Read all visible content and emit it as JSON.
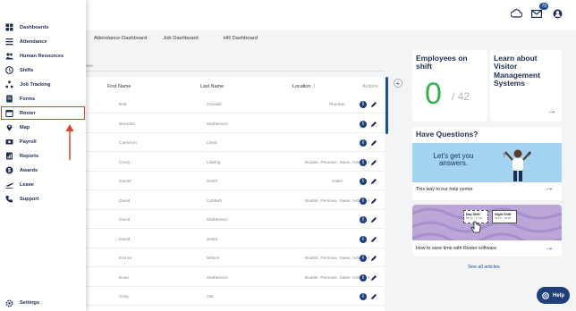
{
  "header": {
    "icons": [
      "cloud-icon",
      "mail-icon",
      "user-icon"
    ],
    "mail_badge": "79"
  },
  "tabs": [
    "Attendance Dashboard",
    "Job Dashboard",
    "HR Dashboard"
  ],
  "tab_partial": "ees",
  "table": {
    "headers": {
      "first": "First Name",
      "last": "Last Name",
      "location": "Location ⋮",
      "actions": "Actions"
    },
    "rows": [
      {
        "first": "Bob",
        "last": "Goodall",
        "location": "Plumber"
      },
      {
        "first": "Brandon",
        "last": "Matheeson",
        "location": ""
      },
      {
        "first": "Cameron",
        "last": "Lloyd",
        "location": ""
      },
      {
        "first": "Crazy",
        "last": "Littelrig",
        "location": "Builder, Pennisie, Sales, Admin , Finance,..."
      },
      {
        "first": "Daniel",
        "last": "Smith",
        "location": "Sales"
      },
      {
        "first": "David",
        "last": "Cobbett",
        "location": "Builder, Pennisie, Sales, Admin , Finance,..."
      },
      {
        "first": "David",
        "last": "Matheeson",
        "location": ""
      },
      {
        "first": "David",
        "last": "Smith",
        "location": ""
      },
      {
        "first": "Emma",
        "last": "Wilson",
        "location": "Builder, Pennisie, Sales, Admin , Finance,..."
      },
      {
        "first": "Euan",
        "last": "Matheeson",
        "location": "Builder, Pennisie, Sales, Admin , Finance,..."
      },
      {
        "first": "Greg",
        "last": "Olu",
        "location": ""
      }
    ]
  },
  "sidebar": {
    "items": [
      {
        "label": "Dashboards",
        "icon": "dashboard-icon"
      },
      {
        "label": "Attendance",
        "icon": "list-icon"
      },
      {
        "label": "Human Resources",
        "icon": "people-icon"
      },
      {
        "label": "Shifts",
        "icon": "clock-icon"
      },
      {
        "label": "Job Tracking",
        "icon": "tracking-icon"
      },
      {
        "label": "Forms",
        "icon": "forms-icon"
      },
      {
        "label": "Roster",
        "icon": "calendar-icon"
      },
      {
        "label": "Map",
        "icon": "map-pin-icon"
      },
      {
        "label": "Payroll",
        "icon": "payroll-icon"
      },
      {
        "label": "Reports",
        "icon": "reports-icon"
      },
      {
        "label": "Awards",
        "icon": "dollar-icon"
      },
      {
        "label": "Leave",
        "icon": "plane-icon"
      },
      {
        "label": "Support",
        "icon": "phone-icon"
      }
    ],
    "settings": "Settings"
  },
  "right": {
    "employees_title": "Employees on shift",
    "employees_count": "0",
    "employees_total": "/ 42",
    "learn_title": "Learn about Visitor Management Systems",
    "questions_title": "Have Questions?",
    "banner_text": "Let's get you answers.",
    "help_centre_link": "This way to our help centre",
    "roster_link": "How to save time with Roster software",
    "day_shift": "Day Shift",
    "day_shift_time": "08:00 – 17:00",
    "night_shift": "Night Shift",
    "night_shift_time": "18:00 – 23:00",
    "see_all": "See all articles",
    "help_button": "Help"
  },
  "colors": {
    "accent": "#1f4e9a",
    "green": "#35b34a",
    "highlight": "#d84432"
  }
}
